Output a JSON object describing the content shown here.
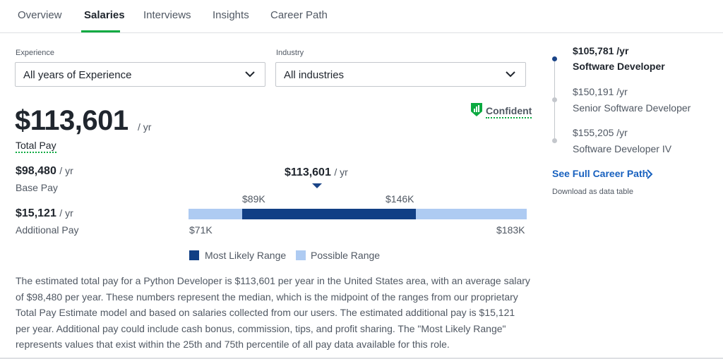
{
  "tabs": [
    {
      "label": "Overview"
    },
    {
      "label": "Salaries"
    },
    {
      "label": "Interviews"
    },
    {
      "label": "Insights"
    },
    {
      "label": "Career Path"
    }
  ],
  "filters": {
    "experience": {
      "label": "Experience",
      "value": "All years of Experience"
    },
    "industry": {
      "label": "Industry",
      "value": "All industries"
    }
  },
  "total_pay": {
    "amount": "$113,601",
    "unit": "/ yr",
    "label": "Total Pay",
    "confidence": "Confident"
  },
  "base_pay": {
    "amount": "$98,480",
    "unit": "/ yr",
    "label": "Base Pay"
  },
  "additional_pay": {
    "amount": "$15,121",
    "unit": "/ yr",
    "label": "Additional Pay"
  },
  "range": {
    "median": "$113,601",
    "median_unit": "/ yr",
    "likely_low": "$89K",
    "likely_high": "$146K",
    "possible_low": "$71K",
    "possible_high": "$183K",
    "legend_likely": "Most Likely Range",
    "legend_possible": "Possible Range",
    "colors": {
      "likely": "#113f85",
      "possible": "#aecbf2"
    }
  },
  "description": "The estimated total pay for a Python Developer is $113,601 per year in the United States area, with an average salary of $98,480 per year. These numbers represent the median, which is the midpoint of the ranges from our proprietary Total Pay Estimate model and based on salaries collected from our users. The estimated additional pay is $15,121 per year. Additional pay could include cash bonus, commission, tips, and profit sharing. The \"Most Likely Range\" represents values that exist within the 25th and 75th percentile of all pay data available for this role.",
  "career_path": {
    "steps": [
      {
        "salary": "$105,781 /yr",
        "title": "Software Developer"
      },
      {
        "salary": "$150,191 /yr",
        "title": "Senior Software Developer"
      },
      {
        "salary": "$155,205 /yr",
        "title": "Software Developer IV"
      }
    ],
    "link": "See Full Career Path",
    "download": "Download as data table"
  },
  "colors": {
    "accent_green": "#0caa41",
    "link_blue": "#1861bf"
  },
  "icons": {
    "confidence": "shield-bar-chart-icon",
    "select": "chevron-down-icon",
    "link": "chevron-right-icon"
  }
}
